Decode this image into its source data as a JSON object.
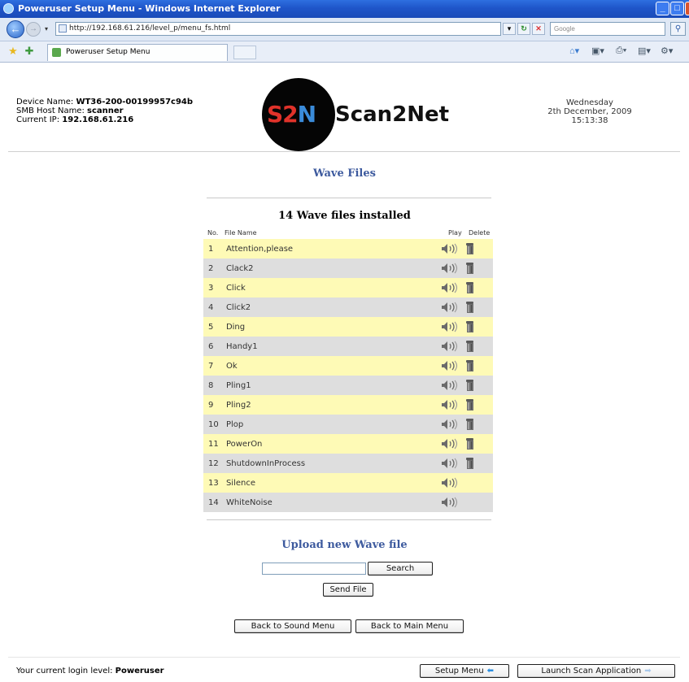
{
  "window": {
    "title": "Poweruser Setup Menu - Windows Internet Explorer",
    "min_label": "_",
    "max_label": "□",
    "close_label": "×"
  },
  "browser": {
    "url": "http://192.168.61.216/level_p/menu_fs.html",
    "search_placeholder": "Google",
    "tab_title": "Poweruser Setup Menu"
  },
  "header": {
    "device_label": "Device Name:",
    "device_value": "WT36-200-00199957c94b",
    "host_label": "SMB Host Name:",
    "host_value": "scanner",
    "ip_label": "Current IP:",
    "ip_value": "192.168.61.216",
    "logo_text": "Scan2Net",
    "logo_badge": "S2N",
    "date_day": "Wednesday",
    "date_full": "2th December, 2009",
    "time": "15:13:38"
  },
  "page": {
    "title": "Wave Files",
    "count_text": "14 Wave files installed",
    "columns": {
      "no": "No.",
      "name": "File Name",
      "play": "Play",
      "delete": "Delete"
    }
  },
  "files": [
    {
      "no": "1",
      "name": "Attention,please",
      "deletable": true
    },
    {
      "no": "2",
      "name": "Clack2",
      "deletable": true
    },
    {
      "no": "3",
      "name": "Click",
      "deletable": true
    },
    {
      "no": "4",
      "name": "Click2",
      "deletable": true
    },
    {
      "no": "5",
      "name": "Ding",
      "deletable": true
    },
    {
      "no": "6",
      "name": "Handy1",
      "deletable": true
    },
    {
      "no": "7",
      "name": "Ok",
      "deletable": true
    },
    {
      "no": "8",
      "name": "Pling1",
      "deletable": true
    },
    {
      "no": "9",
      "name": "Pling2",
      "deletable": true
    },
    {
      "no": "10",
      "name": "Plop",
      "deletable": true
    },
    {
      "no": "11",
      "name": "PowerOn",
      "deletable": true
    },
    {
      "no": "12",
      "name": "ShutdownInProcess",
      "deletable": true
    },
    {
      "no": "13",
      "name": "Silence",
      "deletable": false
    },
    {
      "no": "14",
      "name": "WhiteNoise",
      "deletable": false
    }
  ],
  "upload": {
    "title": "Upload new Wave file",
    "file_value": "",
    "browse_label": "Search",
    "send_label": "Send File"
  },
  "nav": {
    "back_sound": "Back to Sound Menu",
    "back_main": "Back to Main Menu"
  },
  "footer": {
    "login_label": "Your current login level:",
    "login_value": "Poweruser",
    "setup_menu": "Setup Menu",
    "launch": "Launch Scan Application"
  },
  "colors": {
    "row_odd": "#fefab6",
    "row_even": "#dedede",
    "title_blue": "#3d5a9e"
  }
}
